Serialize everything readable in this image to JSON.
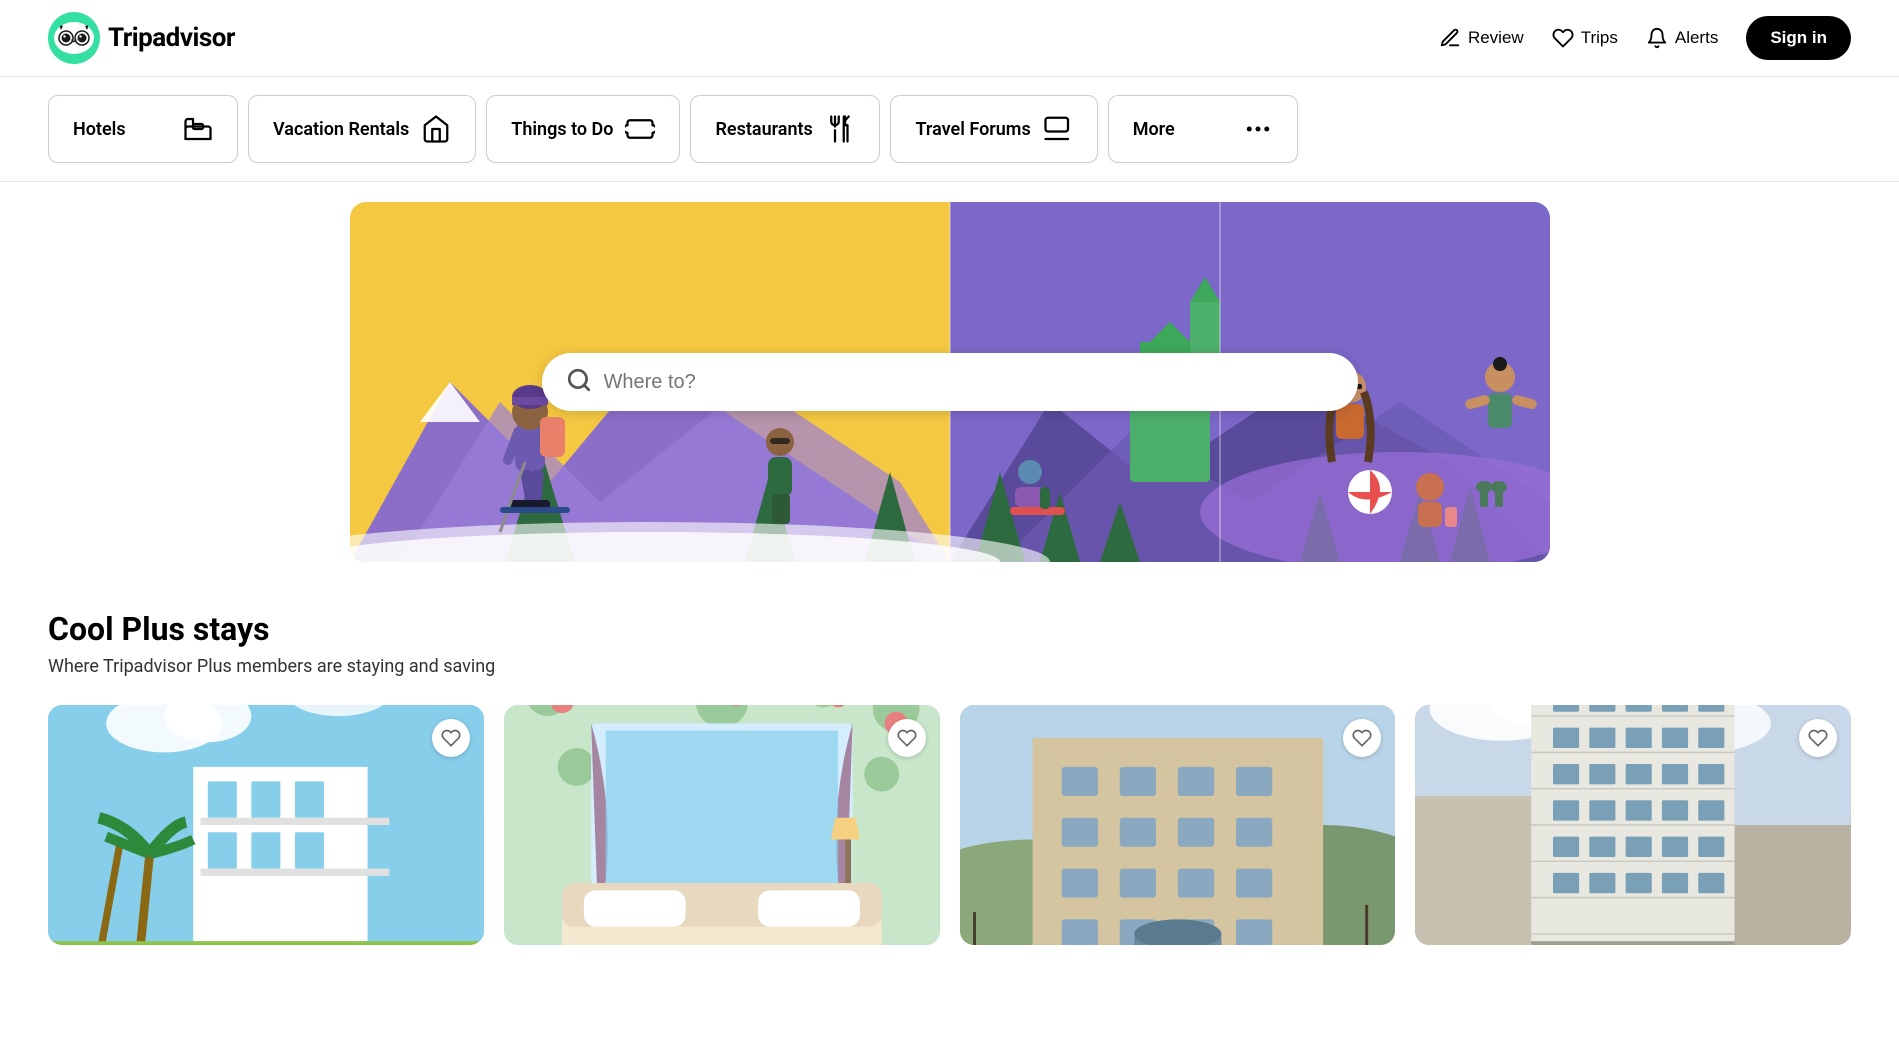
{
  "header": {
    "logo_text": "Tripadvisor",
    "nav": {
      "review_label": "Review",
      "trips_label": "Trips",
      "alerts_label": "Alerts",
      "signin_label": "Sign in"
    }
  },
  "nav_tabs": [
    {
      "id": "hotels",
      "label": "Hotels",
      "icon": "bed"
    },
    {
      "id": "vacation-rentals",
      "label": "Vacation Rentals",
      "icon": "home"
    },
    {
      "id": "things-to-do",
      "label": "Things to Do",
      "icon": "ticket"
    },
    {
      "id": "restaurants",
      "label": "Restaurants",
      "icon": "fork"
    },
    {
      "id": "travel-forums",
      "label": "Travel Forums",
      "icon": "flag"
    },
    {
      "id": "more",
      "label": "More",
      "icon": "dots"
    }
  ],
  "search": {
    "placeholder": "Where to?"
  },
  "cool_plus": {
    "title": "Cool Plus stays",
    "subtitle": "Where Tripadvisor Plus members are staying and saving"
  },
  "cards": [
    {
      "id": "card-1",
      "alt": "Hotel with palm trees"
    },
    {
      "id": "card-2",
      "alt": "Hotel interior with floral wallpaper"
    },
    {
      "id": "card-3",
      "alt": "Building exterior"
    },
    {
      "id": "card-4",
      "alt": "High rise hotel"
    }
  ]
}
